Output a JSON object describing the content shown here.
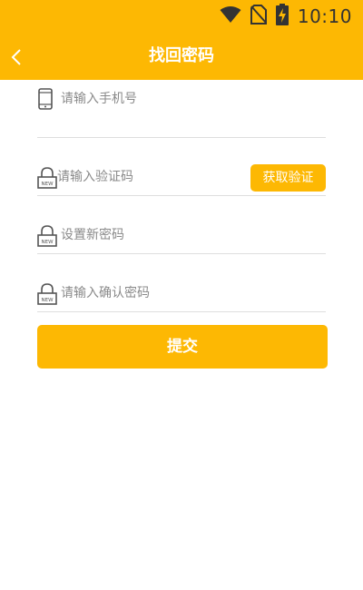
{
  "status_bar": {
    "time": "10:10",
    "icons": [
      "wifi-icon",
      "no-sim-icon",
      "battery-charging-icon"
    ]
  },
  "header": {
    "title": "找回密码",
    "back_icon": "chevron-left-icon"
  },
  "form": {
    "phone": {
      "placeholder": "请输入手机号",
      "icon": "phone-icon"
    },
    "code": {
      "placeholder": "请输入验证码",
      "icon": "lock-icon",
      "button_label": "获取验证"
    },
    "new_password": {
      "placeholder": "设置新密码",
      "icon": "lock-icon"
    },
    "confirm_password": {
      "placeholder": "请输入确认密码",
      "icon": "lock-icon"
    }
  },
  "submit": {
    "label": "提交"
  },
  "colors": {
    "accent": "#FDB803",
    "divider": "#dedede",
    "placeholder": "#8a8a8a"
  }
}
